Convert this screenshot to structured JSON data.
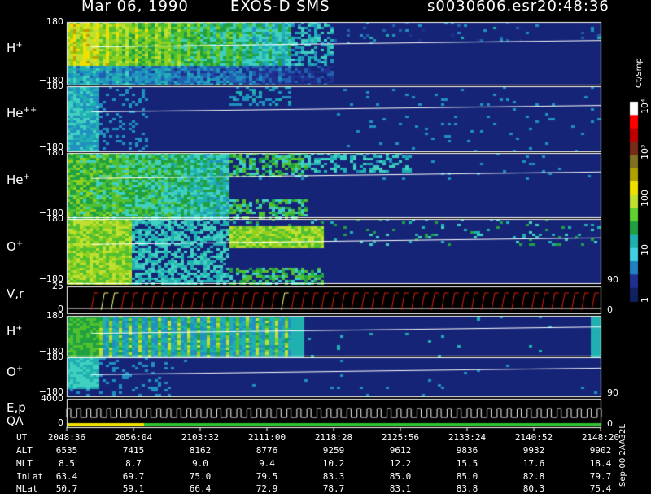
{
  "header": {
    "date": "Mar 06, 1990",
    "instrument": "EXOS-D SMS",
    "filename": "s0030606.esr",
    "time": "20:48:36"
  },
  "colorbar": {
    "unit_label": "Ct/Smp",
    "tick_labels": [
      "10⁴",
      "10³",
      "100",
      "10",
      "1"
    ],
    "tick_values": [
      10000,
      1000,
      100,
      10,
      1
    ],
    "colors": [
      "#ffffff",
      "#ff0000",
      "#c00000",
      "#7a2a1a",
      "#807020",
      "#b0a000",
      "#f0e000",
      "#c0e030",
      "#60d030",
      "#20a040",
      "#20b0b0",
      "#40d0e0",
      "#2080c0",
      "#203090",
      "#102060"
    ]
  },
  "side_note": "Sep-00  2AA32L",
  "bottom_table": {
    "row_labels": [
      "UT",
      "ALT",
      "MLT",
      "InLat",
      "MLat"
    ],
    "columns": [
      [
        "2048:36",
        "6535",
        "8.5",
        "63.4",
        "50.7"
      ],
      [
        "2056:04",
        "7415",
        "8.7",
        "69.7",
        "59.1"
      ],
      [
        "2103:32",
        "8162",
        "9.0",
        "75.0",
        "66.4"
      ],
      [
        "2111:00",
        "8776",
        "9.4",
        "79.5",
        "72.9"
      ],
      [
        "2118:28",
        "9259",
        "10.2",
        "83.3",
        "78.7"
      ],
      [
        "2125:56",
        "9612",
        "12.2",
        "85.0",
        "83.1"
      ],
      [
        "2133:24",
        "9836",
        "15.5",
        "85.0",
        "83.8"
      ],
      [
        "2140:52",
        "9932",
        "17.6",
        "82.8",
        "80.3"
      ],
      [
        "2148:20",
        "9902",
        "18.4",
        "79.7",
        "75.4"
      ]
    ]
  },
  "chart_data": {
    "type": "heatmap",
    "panels": [
      {
        "label": "H",
        "sup": "+",
        "y_top": "180",
        "y_bottom": "−180",
        "ylim": [
          -180,
          180
        ],
        "right_tick": ""
      },
      {
        "label": "He",
        "sup": "++",
        "y_top": "180",
        "y_bottom": "−180",
        "ylim": [
          -180,
          180
        ],
        "right_tick": ""
      },
      {
        "label": "He",
        "sup": "+",
        "y_top": "180",
        "y_bottom": "−180",
        "ylim": [
          -180,
          180
        ],
        "right_tick": ""
      },
      {
        "label": "O",
        "sup": "+",
        "y_top": "180",
        "y_bottom": "−180",
        "ylim": [
          -180,
          180
        ],
        "right_tick": "90"
      },
      {
        "label": "V,r",
        "sup": "",
        "y_top": "25",
        "y_bottom": "0",
        "ylim": [
          0,
          25
        ],
        "right_tick": "0",
        "kind": "line"
      },
      {
        "label": "H",
        "sup": "+",
        "y_top": "180",
        "y_bottom": "−180",
        "ylim": [
          -180,
          180
        ],
        "right_tick": ""
      },
      {
        "label": "O",
        "sup": "+",
        "y_top": "180",
        "y_bottom": "−180",
        "ylim": [
          -180,
          180
        ],
        "right_tick": "90"
      },
      {
        "label": "E,p",
        "label2": "QA",
        "sup": "",
        "y_top": "4000",
        "y_bottom": "0",
        "ylim": [
          0,
          4000
        ],
        "right_tick": "0",
        "kind": "line"
      }
    ],
    "x_tick_labels": [
      "2048:36",
      "2056:04",
      "2103:32",
      "2111:00",
      "2118:28",
      "2125:56",
      "2133:24",
      "2140:52",
      "2148:20"
    ],
    "color_scale": "log",
    "color_range": [
      1,
      10000
    ]
  }
}
